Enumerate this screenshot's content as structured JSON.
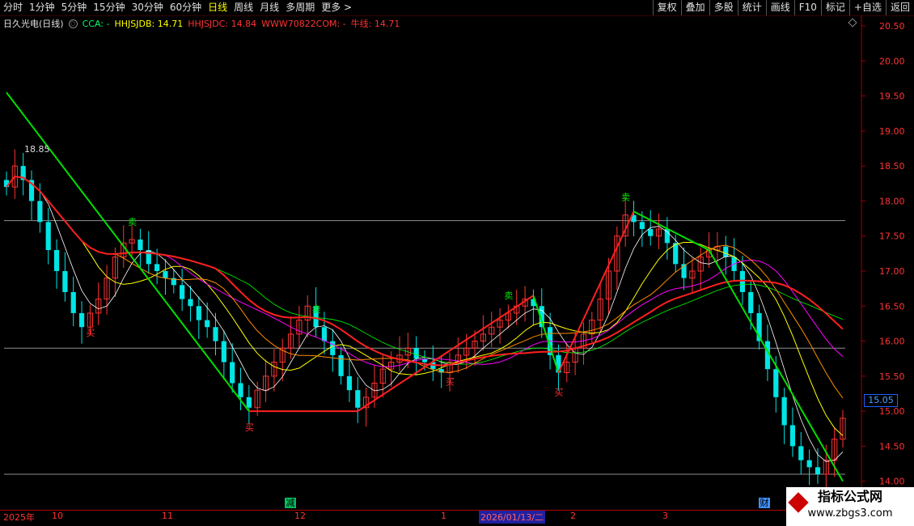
{
  "toolbar": {
    "tabs": [
      "分时",
      "1分钟",
      "5分钟",
      "15分钟",
      "30分钟",
      "60分钟",
      "日线",
      "周线",
      "月线",
      "多周期",
      "更多 >"
    ],
    "active_tab": "日线",
    "tools": [
      "复权",
      "叠加",
      "多股",
      "统计",
      "画线",
      "F10",
      "标记",
      "+自选",
      "返回"
    ]
  },
  "legend": {
    "stock": "日久光电(日线)",
    "cca": "CCA: -",
    "hhjsjdb": "HHJSJDB: 14.71",
    "hhjsjdc": "HHJSJDC: 14.84",
    "www": "WWW70822COM: -",
    "niuxian": "牛线: 14.71"
  },
  "max_label": "18.85",
  "current_price": "15.05",
  "colors": {
    "up": "#ff3333",
    "down": "#00e5e5",
    "bg": "#000000",
    "axis": "#ff3333",
    "grid": "#7a0000"
  },
  "x_axis": {
    "labels": [
      "2025年",
      "10",
      "11",
      "12",
      "1",
      "2026/01/13/二",
      "2",
      "3"
    ],
    "events": [
      "减",
      "财"
    ]
  },
  "watermark": {
    "title": "指标公式网",
    "url": "www.zbgs3.com"
  },
  "chart_data": {
    "type": "candlestick",
    "ylim": [
      13.95,
      20.65
    ],
    "y_ticks": [
      "20.50",
      "20.00",
      "19.50",
      "19.00",
      "18.50",
      "18.00",
      "17.50",
      "17.00",
      "16.50",
      "16.00",
      "15.50",
      "15.00",
      "14.50",
      "14.00"
    ],
    "horizontal_lines": [
      17.72,
      15.9,
      14.1
    ],
    "signals": {
      "buy": "买",
      "sell": "卖"
    },
    "close": [
      18.2,
      18.5,
      18.3,
      18.0,
      17.7,
      17.3,
      17.0,
      16.7,
      16.4,
      16.2,
      16.4,
      16.6,
      16.9,
      17.2,
      17.4,
      17.45,
      17.3,
      17.1,
      17.0,
      16.9,
      16.8,
      16.6,
      16.5,
      16.3,
      16.2,
      16.0,
      15.7,
      15.4,
      15.2,
      15.05,
      15.3,
      15.5,
      15.7,
      15.9,
      16.1,
      16.3,
      16.5,
      16.2,
      16.0,
      15.8,
      15.5,
      15.3,
      15.05,
      15.2,
      15.4,
      15.6,
      15.7,
      15.8,
      15.9,
      15.75,
      15.7,
      15.6,
      15.55,
      15.7,
      15.8,
      15.9,
      16.0,
      16.1,
      16.2,
      16.3,
      16.4,
      16.5,
      16.6,
      16.5,
      16.2,
      15.8,
      15.55,
      15.7,
      15.9,
      16.1,
      16.3,
      16.6,
      17.0,
      17.5,
      17.8,
      17.7,
      17.6,
      17.5,
      17.6,
      17.4,
      17.1,
      16.9,
      17.0,
      17.2,
      17.3,
      17.35,
      17.2,
      17.0,
      16.7,
      16.4,
      16.0,
      15.6,
      15.2,
      14.8,
      14.5,
      14.3,
      14.2,
      14.1,
      14.3,
      14.6,
      14.9
    ]
  }
}
